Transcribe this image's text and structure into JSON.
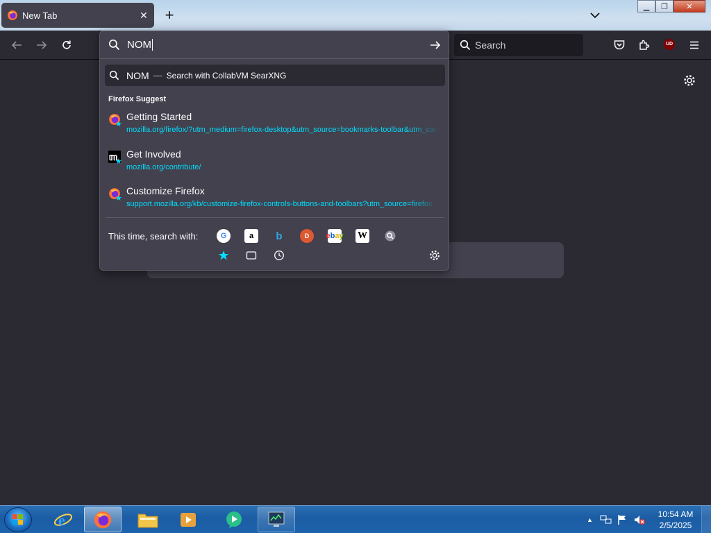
{
  "tab": {
    "title": "New Tab"
  },
  "urlbar": {
    "value": "NOM"
  },
  "searchbar": {
    "placeholder": "Search"
  },
  "heuristic": {
    "query": "NOM",
    "dash": "—",
    "action": "Search with CollabVM SearXNG"
  },
  "suggest_group": {
    "label": "Firefox Suggest"
  },
  "suggestions": [
    {
      "title": "Getting Started",
      "url": "mozilla.org/firefox/?utm_medium=firefox-desktop&utm_source=bookmarks-toolbar&utm_campaign=new-users"
    },
    {
      "title": "Get Involved",
      "url": "mozilla.org/contribute/"
    },
    {
      "title": "Customize Firefox",
      "url": "support.mozilla.org/kb/customize-firefox-controls-buttons-and-toolbars?utm_source=firefox"
    }
  ],
  "oneoff": {
    "label": "This time, search with:",
    "engines": [
      "Google",
      "Amazon",
      "Bing",
      "DuckDuckGo",
      "eBay",
      "Wikipedia",
      "SearXNG"
    ]
  },
  "extension": {
    "ubo_label": "UD"
  },
  "clock": {
    "time": "10:54 AM",
    "date": "2/5/2025"
  },
  "colors": {
    "accent": "#00ddff",
    "popup_bg": "#42414d",
    "page_bg": "#2b2a33"
  }
}
